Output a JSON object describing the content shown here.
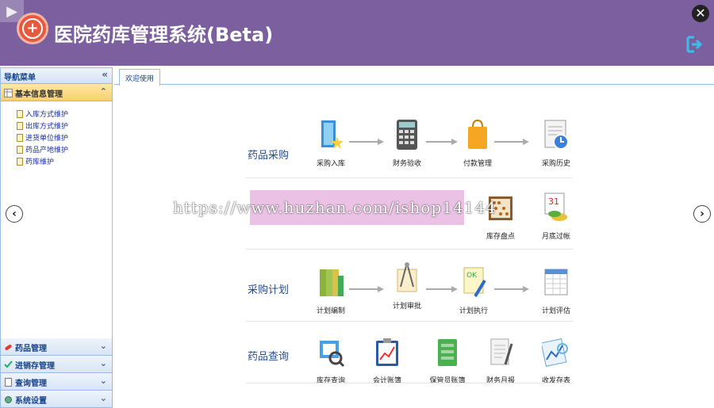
{
  "header": {
    "title": "医院药库管理系统(Beta)"
  },
  "sidebar": {
    "title": "导航菜单",
    "collapse_icon": "«",
    "sections": [
      {
        "label": "基本信息管理",
        "active": true
      },
      {
        "label": "药品管理"
      },
      {
        "label": "进销存管理"
      },
      {
        "label": "查询管理"
      },
      {
        "label": "系统设置"
      }
    ],
    "items": [
      "入库方式维护",
      "出库方式维护",
      "进货单位维护",
      "药品产地维护",
      "药库维护"
    ]
  },
  "tabs": [
    {
      "label": "欢迎使用"
    }
  ],
  "rows": [
    {
      "label": "药品采购",
      "nodes": [
        "采购入库",
        "财务验收",
        "付款管理",
        "采购历史"
      ]
    },
    {
      "label": "",
      "nodes": [
        "",
        "",
        "",
        "库存盘点",
        "月底过帐"
      ]
    },
    {
      "label": "采购计划",
      "nodes": [
        "计划编制",
        "计划审批",
        "计划执行",
        "计划评估"
      ]
    },
    {
      "label": "药品查询",
      "nodes": [
        "库存查询",
        "会计账簿",
        "保管员账簿",
        "财务月报",
        "收发存表"
      ]
    }
  ],
  "watermark": "https://www.huzhan.com/ishop14144"
}
